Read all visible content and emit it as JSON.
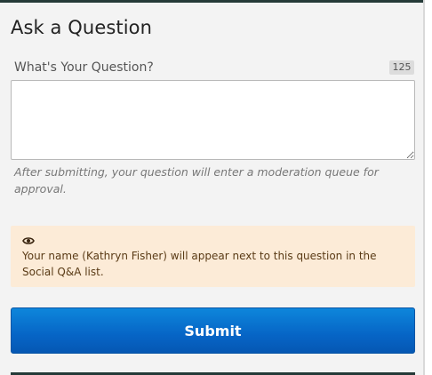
{
  "form": {
    "title": "Ask a Question",
    "question_label": "What's Your Question?",
    "char_count": "125",
    "question_value": "",
    "help_text": "After submitting, your question will enter a moderation queue for approval."
  },
  "notice": {
    "icon": "eye-icon",
    "text": "Your name (Kathryn Fisher) will appear next to this question in the Social Q&A list."
  },
  "actions": {
    "submit_label": "Submit"
  },
  "colors": {
    "accent": "#0665c6",
    "notice_bg": "#fcebd7",
    "header_bar": "#253a38"
  }
}
